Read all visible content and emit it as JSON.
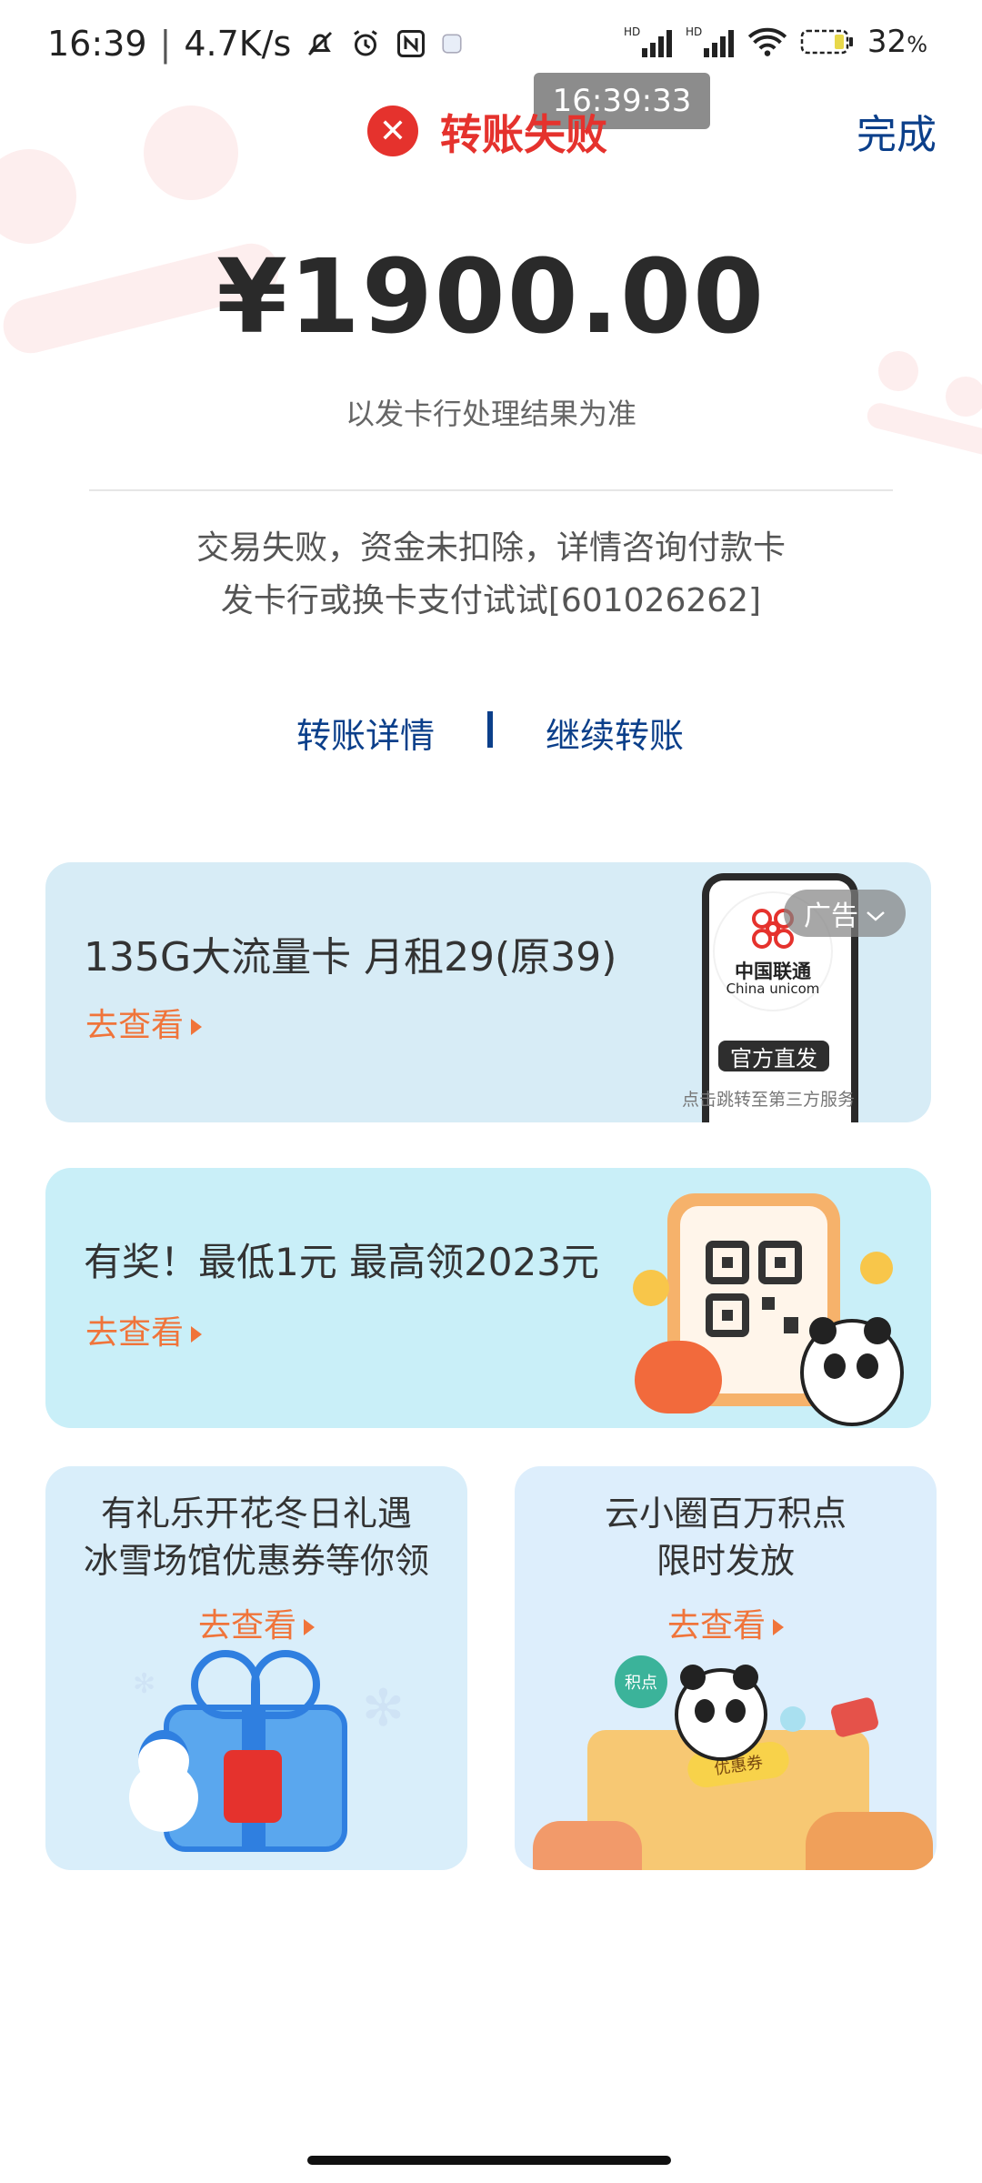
{
  "status_bar": {
    "time": "16:39",
    "speed": "4.7K/s",
    "battery": "32"
  },
  "overlay_timestamp": "16:39:33",
  "header": {
    "status_title": "转账失败",
    "done_label": "完成"
  },
  "amount": "¥1900.00",
  "issuer_note": "以发卡行处理结果为准",
  "message_lines": [
    "交易失败，资金未扣除，详情咨询付款卡",
    "发卡行或换卡支付试试[601026262]"
  ],
  "links": {
    "detail": "转账详情",
    "continue": "继续转账"
  },
  "cards": [
    {
      "title": "135G大流量卡 月租29(原39)",
      "cta": "去查看",
      "ad_badge": "广告",
      "brand_cn": "中国联通",
      "brand_en": "China unicom",
      "tag": "官方直发",
      "footnote": "点击跳转至第三方服务"
    },
    {
      "title": "有奖！最低1元 最高领2023元",
      "cta": "去查看"
    },
    {
      "title_lines": [
        "有礼乐开花冬日礼遇",
        "冰雪场馆优惠券等你领"
      ],
      "cta": "去查看"
    },
    {
      "title_lines": [
        "云小圈百万积点",
        "限时发放"
      ],
      "cta": "去查看",
      "sticker1": "积点",
      "sticker2": "优惠券"
    }
  ],
  "colors": {
    "fail_red": "#e5322d",
    "link_blue": "#0b3f8a",
    "cta_orange": "#f0743a"
  }
}
